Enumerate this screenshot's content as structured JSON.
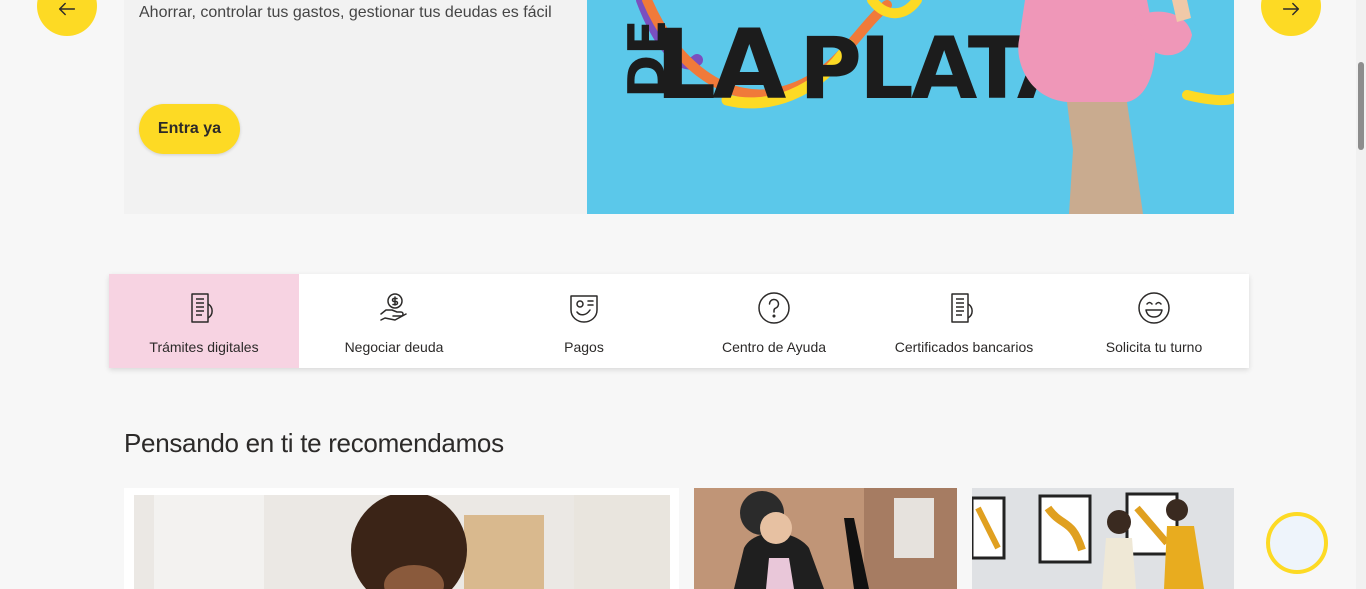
{
  "hero": {
    "description": "Ahorrar, controlar tus gastos, gestionar tus deudas es fácil",
    "cta_label": "Entra ya",
    "image_text": [
      "DE",
      "LA",
      "PLATA"
    ]
  },
  "quick_links": [
    {
      "label": "Trámites digitales",
      "icon": "document-icon",
      "active": true
    },
    {
      "label": "Negociar deuda",
      "icon": "money-hand-icon",
      "active": false
    },
    {
      "label": "Pagos",
      "icon": "payment-icon",
      "active": false
    },
    {
      "label": "Centro de Ayuda",
      "icon": "help-icon",
      "active": false
    },
    {
      "label": "Certificados bancarios",
      "icon": "certificate-icon",
      "active": false
    },
    {
      "label": "Solicita tu turno",
      "icon": "smile-icon",
      "active": false
    }
  ],
  "recommendations": {
    "title": "Pensando en ti te recomendamos"
  },
  "colors": {
    "brand_yellow": "#fdda24",
    "active_tab": "#f7d3e2",
    "hero_blue": "#5bc8ea",
    "text": "#2c2a29"
  }
}
